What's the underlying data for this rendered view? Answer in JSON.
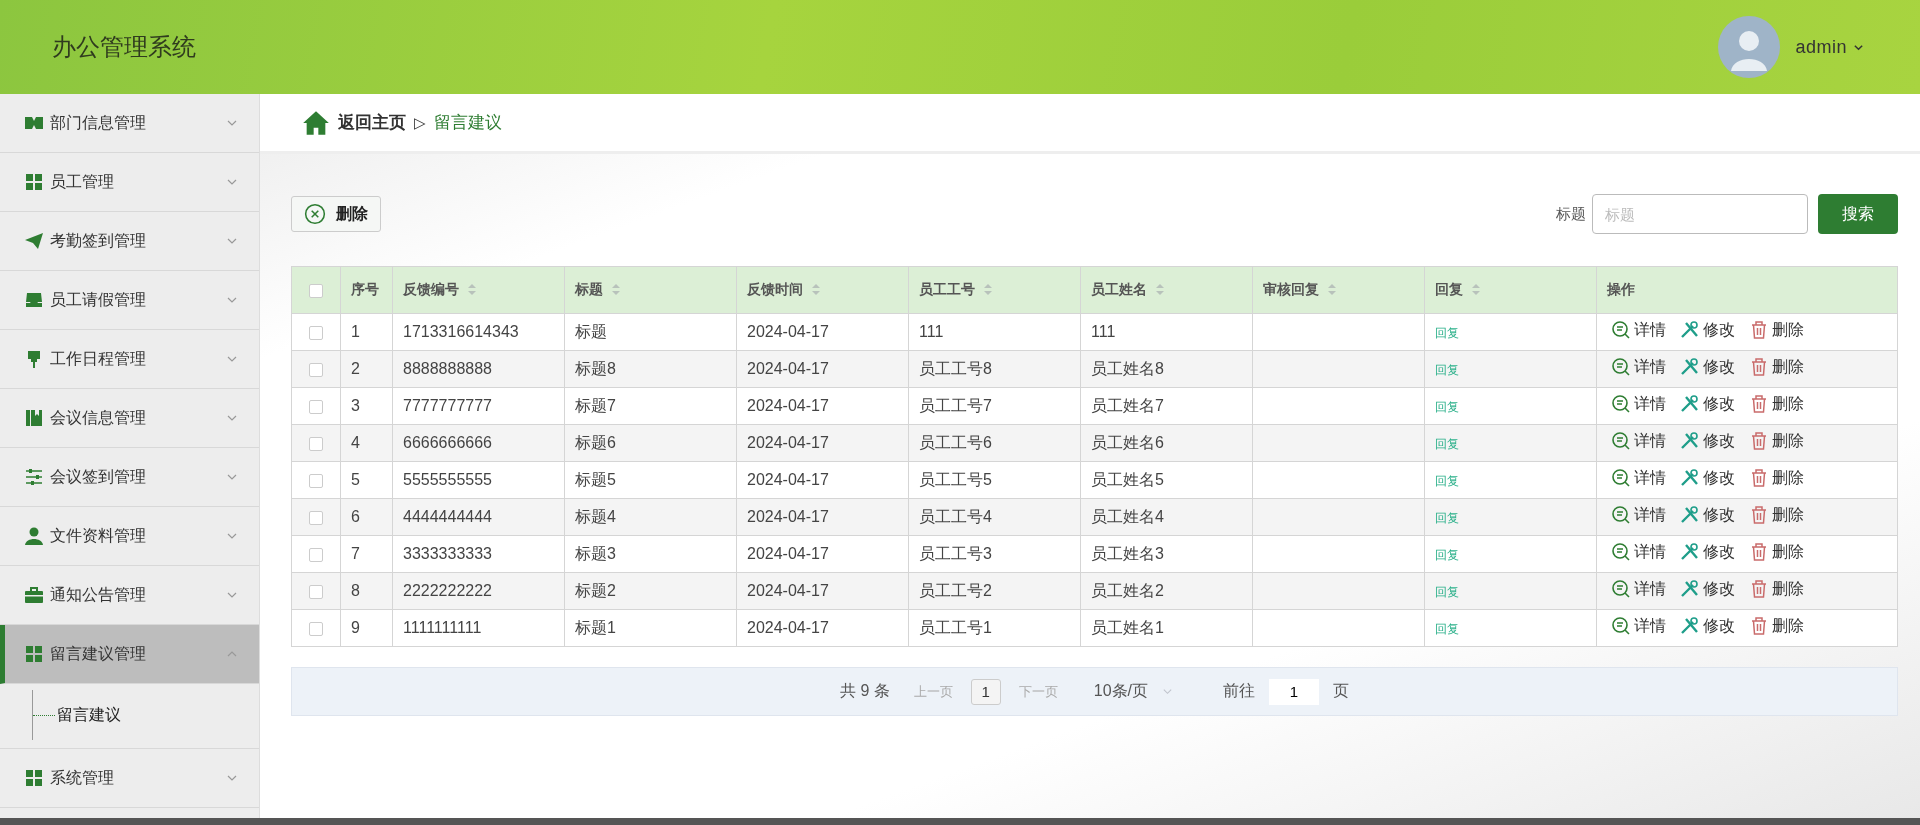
{
  "header": {
    "title": "办公管理系统",
    "user": "admin"
  },
  "sidebar": {
    "items": [
      {
        "label": "部门信息管理",
        "expanded": false,
        "selected": false
      },
      {
        "label": "员工管理",
        "expanded": false,
        "selected": false
      },
      {
        "label": "考勤签到管理",
        "expanded": false,
        "selected": false
      },
      {
        "label": "员工请假管理",
        "expanded": false,
        "selected": false
      },
      {
        "label": "工作日程管理",
        "expanded": false,
        "selected": false
      },
      {
        "label": "会议信息管理",
        "expanded": false,
        "selected": false
      },
      {
        "label": "会议签到管理",
        "expanded": false,
        "selected": false
      },
      {
        "label": "文件资料管理",
        "expanded": false,
        "selected": false
      },
      {
        "label": "通知公告管理",
        "expanded": false,
        "selected": false
      },
      {
        "label": "留言建议管理",
        "expanded": true,
        "selected": true,
        "children": [
          {
            "label": "留言建议"
          }
        ]
      },
      {
        "label": "系统管理",
        "expanded": false,
        "selected": false
      }
    ]
  },
  "breadcrumb": {
    "home": "返回主页",
    "separator": "▷",
    "current": "留言建议"
  },
  "toolbar": {
    "delete_button": "删除",
    "search_label": "标题",
    "search_placeholder": "标题",
    "search_button": "搜索"
  },
  "table": {
    "header_checked": false,
    "columns": [
      {
        "label": "序号",
        "sortable": false
      },
      {
        "label": "反馈编号",
        "sortable": true
      },
      {
        "label": "标题",
        "sortable": true
      },
      {
        "label": "反馈时间",
        "sortable": true
      },
      {
        "label": "员工工号",
        "sortable": true
      },
      {
        "label": "员工姓名",
        "sortable": true
      },
      {
        "label": "审核回复",
        "sortable": true
      },
      {
        "label": "回复",
        "sortable": true
      },
      {
        "label": "操作",
        "sortable": false
      }
    ],
    "rows": [
      {
        "checked": false,
        "cells": [
          "1",
          "1713316614343",
          "标题",
          "2024-04-17",
          "111",
          "111",
          ""
        ],
        "reply": "回复",
        "actions": [
          "详情",
          "修改",
          "删除"
        ]
      },
      {
        "checked": false,
        "cells": [
          "2",
          "8888888888",
          "标题8",
          "2024-04-17",
          "员工工号8",
          "员工姓名8",
          ""
        ],
        "reply": "回复",
        "actions": [
          "详情",
          "修改",
          "删除"
        ]
      },
      {
        "checked": false,
        "cells": [
          "3",
          "7777777777",
          "标题7",
          "2024-04-17",
          "员工工号7",
          "员工姓名7",
          ""
        ],
        "reply": "回复",
        "actions": [
          "详情",
          "修改",
          "删除"
        ]
      },
      {
        "checked": false,
        "cells": [
          "4",
          "6666666666",
          "标题6",
          "2024-04-17",
          "员工工号6",
          "员工姓名6",
          ""
        ],
        "reply": "回复",
        "actions": [
          "详情",
          "修改",
          "删除"
        ]
      },
      {
        "checked": false,
        "cells": [
          "5",
          "5555555555",
          "标题5",
          "2024-04-17",
          "员工工号5",
          "员工姓名5",
          ""
        ],
        "reply": "回复",
        "actions": [
          "详情",
          "修改",
          "删除"
        ]
      },
      {
        "checked": false,
        "cells": [
          "6",
          "4444444444",
          "标题4",
          "2024-04-17",
          "员工工号4",
          "员工姓名4",
          ""
        ],
        "reply": "回复",
        "actions": [
          "详情",
          "修改",
          "删除"
        ]
      },
      {
        "checked": false,
        "cells": [
          "7",
          "3333333333",
          "标题3",
          "2024-04-17",
          "员工工号3",
          "员工姓名3",
          ""
        ],
        "reply": "回复",
        "actions": [
          "详情",
          "修改",
          "删除"
        ]
      },
      {
        "checked": false,
        "cells": [
          "8",
          "2222222222",
          "标题2",
          "2024-04-17",
          "员工工号2",
          "员工姓名2",
          ""
        ],
        "reply": "回复",
        "actions": [
          "详情",
          "修改",
          "删除"
        ]
      },
      {
        "checked": false,
        "cells": [
          "9",
          "1111111111",
          "标题1",
          "2024-04-17",
          "员工工号1",
          "员工姓名1",
          ""
        ],
        "reply": "回复",
        "actions": [
          "详情",
          "修改",
          "删除"
        ]
      }
    ]
  },
  "pagination": {
    "total": "共 9 条",
    "prev": "上一页",
    "pages": [
      {
        "label": "1",
        "selected": true
      }
    ],
    "next": "下一页",
    "page_size": "10条/页",
    "goto_label": "前往",
    "goto_value": "1",
    "goto_suffix": "页"
  }
}
